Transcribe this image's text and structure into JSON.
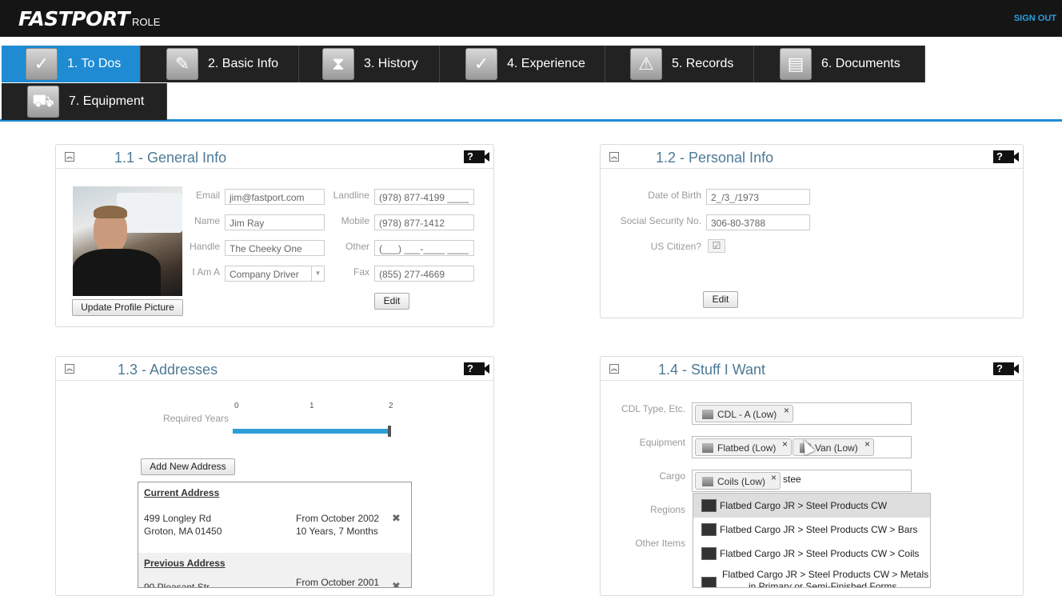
{
  "header": {
    "logo": "FASTPORT",
    "role": "ROLE",
    "signout": "SIGN OUT"
  },
  "tabs": [
    {
      "label": "1. To Dos",
      "icon": "checkmark-icon",
      "active": true
    },
    {
      "label": "2. Basic Info",
      "icon": "documents-pencil-icon"
    },
    {
      "label": "3. History",
      "icon": "hourglass-icon"
    },
    {
      "label": "4. Experience",
      "icon": "checkmark-icon"
    },
    {
      "label": "5. Records",
      "icon": "warning-icon"
    },
    {
      "label": "6. Documents",
      "icon": "documents-icon"
    },
    {
      "label": "7. Equipment",
      "icon": "truck-icon"
    }
  ],
  "general": {
    "title": "1.1 - General Info",
    "labels": {
      "email": "Email",
      "name": "Name",
      "handle": "Handle",
      "iama": "I Am A",
      "landline": "Landline",
      "mobile": "Mobile",
      "other": "Other",
      "fax": "Fax"
    },
    "values": {
      "email": "jim@fastport.com",
      "name": "Jim Ray",
      "handle": "The Cheeky One",
      "iama": "Company Driver",
      "landline": "(978) 877-4199 ____",
      "mobile": "(978) 877-1412",
      "other": "(___) ___-____ ____",
      "fax": "(855) 277-4669"
    },
    "update_pic": "Update Profile Picture",
    "edit": "Edit"
  },
  "personal": {
    "title": "1.2 - Personal Info",
    "labels": {
      "dob": "Date of Birth",
      "ssn": "Social Security No.",
      "citizen": "US Citizen?"
    },
    "values": {
      "dob": "2_/3_/1973",
      "ssn": "306-80-3788"
    },
    "edit": "Edit"
  },
  "addresses": {
    "title": "1.3 - Addresses",
    "required_years_label": "Required Years",
    "scale_ticks": [
      "0",
      "1",
      "2"
    ],
    "required_years_value": 2,
    "add_button": "Add New Address",
    "current": {
      "heading": "Current Address",
      "line1": "499 Longley Rd",
      "line2": "Groton, MA 01450",
      "from": "From October 2002",
      "duration": "10 Years, 7 Months"
    },
    "previous": {
      "heading": "Previous Address",
      "line1": "90 Pleasant Str",
      "from": "From October 2001"
    }
  },
  "stuff": {
    "title": "1.4 - Stuff I Want",
    "labels": {
      "cdl": "CDL Type, Etc.",
      "equipment": "Equipment",
      "cargo": "Cargo",
      "regions": "Regions",
      "other": "Other Items"
    },
    "cdl_tags": [
      "CDL - A (Low)"
    ],
    "equipment_tags": [
      "Flatbed (Low)",
      "Van (Low)"
    ],
    "cargo_tags": [
      "Coils (Low)"
    ],
    "cargo_input": "stee",
    "suggestions": [
      "Flatbed Cargo JR > Steel Products CW",
      "Flatbed Cargo JR > Steel Products CW > Bars",
      "Flatbed Cargo JR > Steel Products CW > Coils",
      "Flatbed Cargo JR > Steel Products CW > Metals",
      "in Primary or Semi-Finished Forms"
    ]
  }
}
